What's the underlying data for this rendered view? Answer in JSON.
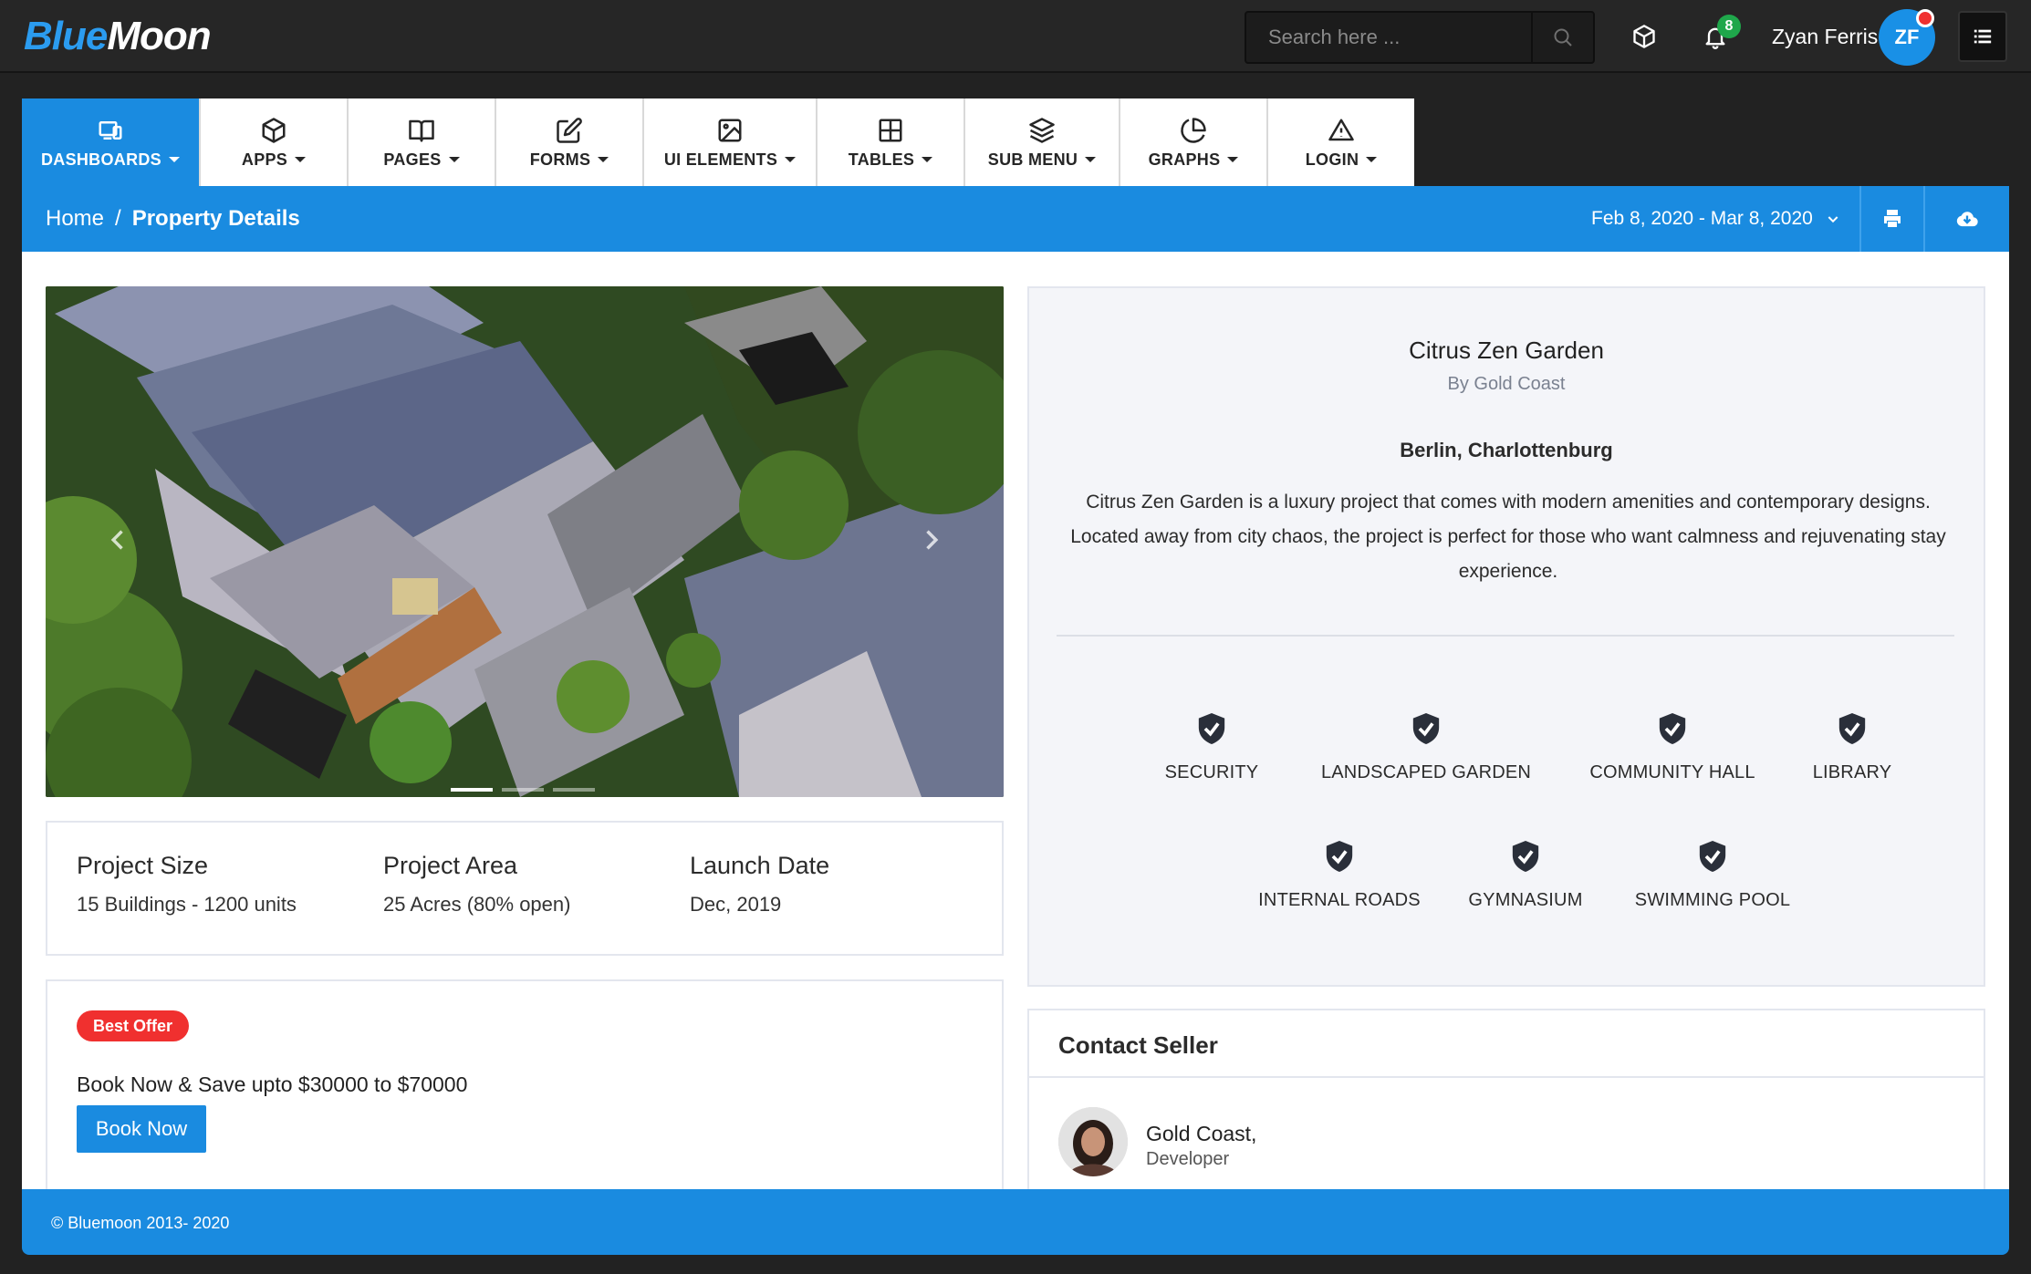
{
  "brand": {
    "logo_part1": "Blue",
    "logo_part2": "Moon"
  },
  "header": {
    "search_placeholder": "Search here ...",
    "notification_count": "8",
    "user_name": "Zyan Ferris",
    "user_initials": "ZF"
  },
  "nav": {
    "tabs": [
      {
        "label": "DASHBOARDS",
        "icon": "devices-icon",
        "active": true
      },
      {
        "label": "APPS",
        "icon": "box-icon"
      },
      {
        "label": "PAGES",
        "icon": "book-icon"
      },
      {
        "label": "FORMS",
        "icon": "edit-icon"
      },
      {
        "label": "UI ELEMENTS",
        "icon": "image-icon"
      },
      {
        "label": "TABLES",
        "icon": "grid-icon"
      },
      {
        "label": "SUB MENU",
        "icon": "layers-icon"
      },
      {
        "label": "GRAPHS",
        "icon": "pie-chart-icon"
      },
      {
        "label": "LOGIN",
        "icon": "alert-triangle-icon"
      }
    ]
  },
  "breadcrumb": {
    "home": "Home",
    "separator": "/",
    "current": "Property Details"
  },
  "date_range": "Feb 8, 2020 - Mar 8, 2020",
  "property": {
    "name": "Citrus Zen Garden",
    "developer_line": "By Gold Coast",
    "location": "Berlin, Charlottenburg",
    "description": "Citrus Zen Garden is a luxury project that comes with modern amenities and contemporary designs. Located away from city chaos, the project is perfect for those who want calmness and rejuvenating stay experience.",
    "amenities": [
      "SECURITY",
      "LANDSCAPED GARDEN",
      "COMMUNITY HALL",
      "LIBRARY",
      "INTERNAL ROADS",
      "GYMNASIUM",
      "SWIMMING POOL"
    ]
  },
  "stats": [
    {
      "label": "Project Size",
      "value": "15 Buildings - 1200 units"
    },
    {
      "label": "Project Area",
      "value": "25 Acres (80% open)"
    },
    {
      "label": "Launch Date",
      "value": "Dec, 2019"
    }
  ],
  "offer": {
    "badge": "Best Offer",
    "text": "Book Now & Save upto $30000 to $70000",
    "button": "Book Now"
  },
  "contact": {
    "title": "Contact Seller",
    "seller_name": "Gold Coast,",
    "seller_role": "Developer"
  },
  "carousel": {
    "slide_count": 3,
    "active_slide": 1
  },
  "footer": {
    "copyright": "© Bluemoon 2013- 2020"
  },
  "colors": {
    "primary": "#1a8be0",
    "danger": "#f0302f",
    "success": "#1fa74b",
    "topbar": "#262626"
  }
}
